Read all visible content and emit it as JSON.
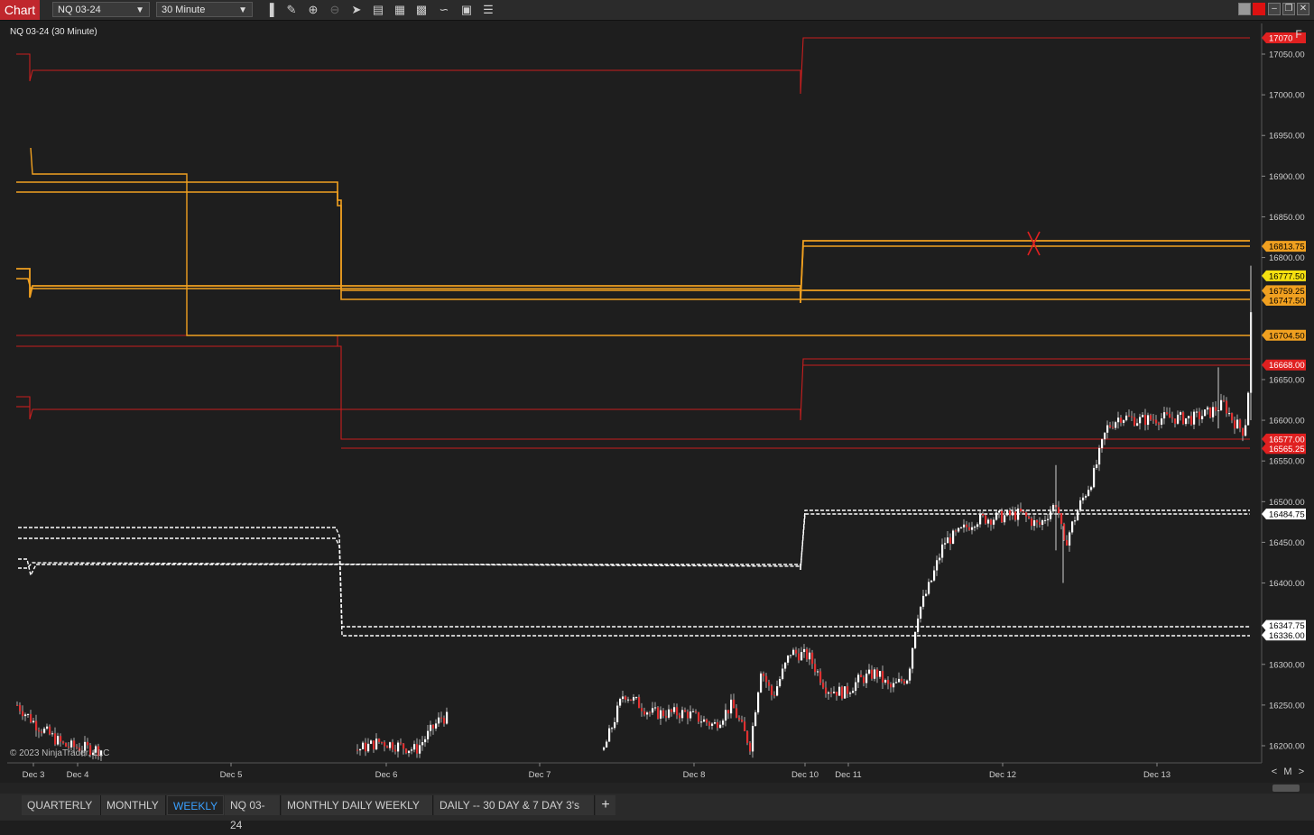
{
  "app": {
    "tag": "Chart"
  },
  "toolbar": {
    "instrument": "NQ 03-24",
    "interval": "30 Minute",
    "icons": [
      "bar-style-icon",
      "draw-icon",
      "zoom-in-icon",
      "zoom-out-icon",
      "pointer-icon",
      "data-box-icon",
      "template-icon",
      "indicators-icon",
      "strategies-icon",
      "properties-icon",
      "list-icon"
    ]
  },
  "chart": {
    "title": "NQ 03-24 (30 Minute)",
    "copyright": "© 2023 NinjaTrader, LLC",
    "corner_button": "F",
    "scroll_left": "<",
    "scroll_mode": "M",
    "scroll_right": ">"
  },
  "chart_data": {
    "type": "candlestick",
    "y_range": [
      16185,
      17085
    ],
    "y_ticks": [
      "17050.00",
      "17000.00",
      "16950.00",
      "16900.00",
      "16850.00",
      "16800.00",
      "16650.00",
      "16600.00",
      "16550.00",
      "16500.00",
      "16450.00",
      "16400.00",
      "16300.00",
      "16250.00",
      "16200.00"
    ],
    "x_labels": [
      "Dec 3",
      "Dec 4",
      "Dec 5",
      "Dec 6",
      "Dec 7",
      "Dec 8",
      "Dec 10",
      "Dec 11",
      "Dec 12",
      "Dec 13"
    ],
    "price_labels": [
      {
        "text": "17070",
        "color": "#e02020"
      },
      {
        "text": "16813.75",
        "color": "#f0a020"
      },
      {
        "text": "16777.50",
        "color": "#f5e010"
      },
      {
        "text": "16759.25",
        "color": "#f0a020"
      },
      {
        "text": "16747.50",
        "color": "#f0a020"
      },
      {
        "text": "16704.50",
        "color": "#f0a020"
      },
      {
        "text": "16668.00",
        "color": "#e02020"
      },
      {
        "text": "16577.00",
        "color": "#e02020"
      },
      {
        "text": "16565.25",
        "color": "#e02020"
      },
      {
        "text": "16484.75",
        "color": "#ffffff"
      },
      {
        "text": "16347.75",
        "color": "#ffffff"
      },
      {
        "text": "16336.00",
        "color": "#ffffff"
      }
    ],
    "colors": {
      "red_level": "#c81e1e",
      "orange_level": "#f0a020",
      "white_level": "#ffffff",
      "up_candle": "#ffffff",
      "down_candle": "#e03030"
    }
  },
  "tabs": [
    {
      "label": "QUARTERLY",
      "active": false
    },
    {
      "label": "MONTHLY",
      "active": false
    },
    {
      "label": "WEEKLY",
      "active": true
    },
    {
      "label": "NQ 03-24",
      "active": false
    },
    {
      "label": "MONTHLY DAILY WEEKLY",
      "active": false
    },
    {
      "label": "DAILY -- 30 DAY & 7 DAY 3's",
      "active": false
    }
  ],
  "tab_add": "+"
}
